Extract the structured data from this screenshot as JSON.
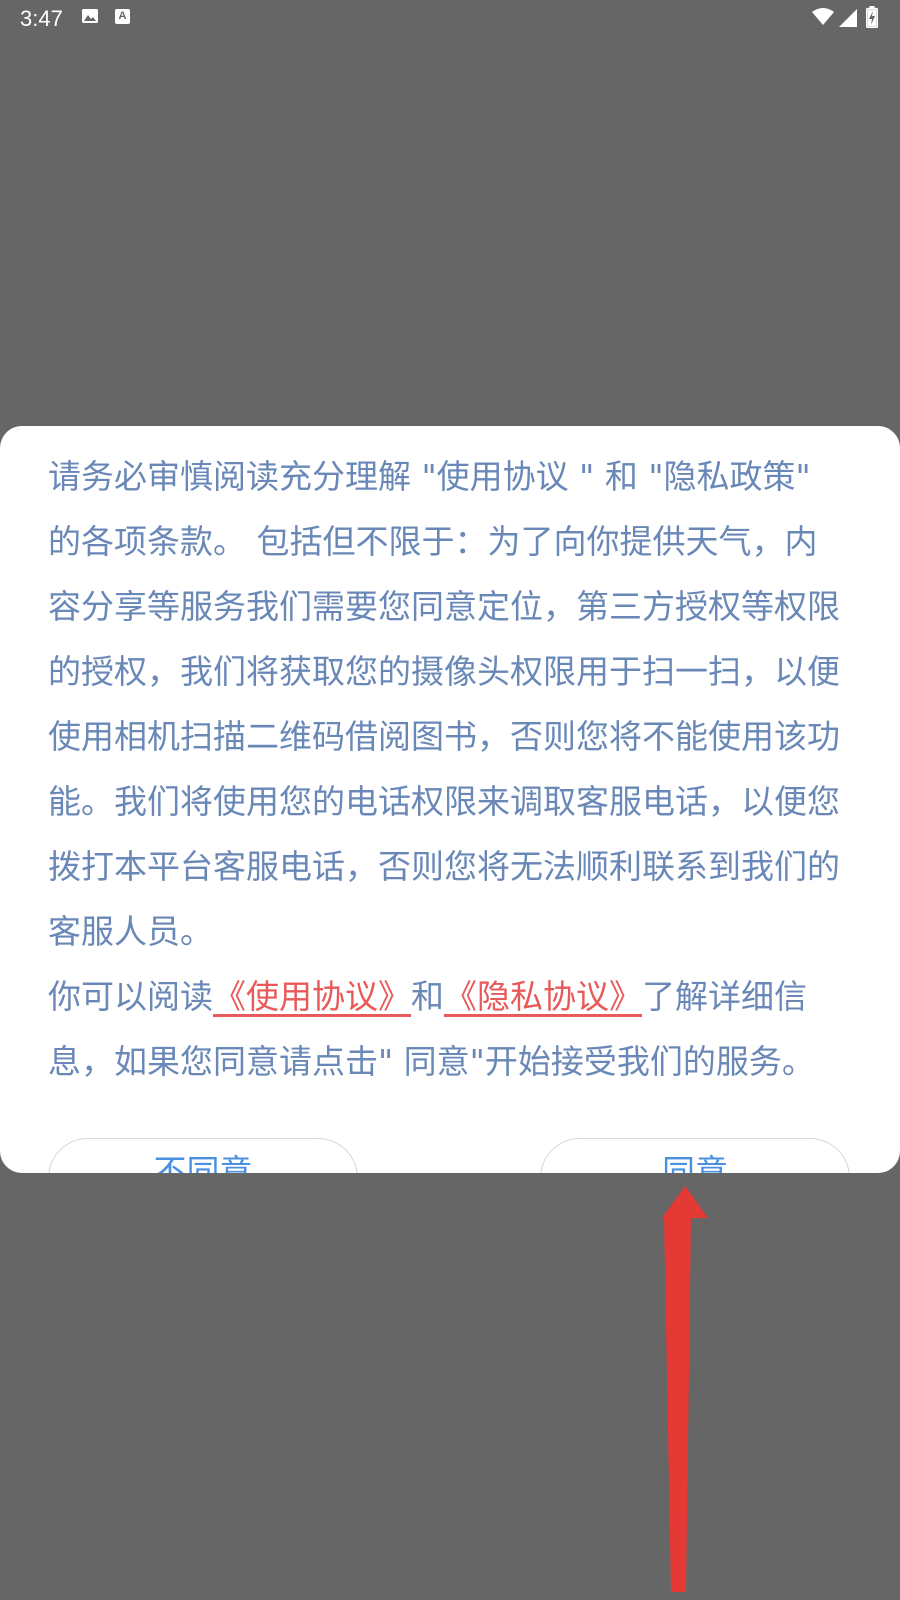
{
  "status_bar": {
    "time": "3:47",
    "notification_icons": [
      "image-icon",
      "text-a-icon"
    ],
    "system_icons": [
      "wifi-icon",
      "signal-icon",
      "battery-charging-icon"
    ]
  },
  "dialog": {
    "paragraph1": "请务必审慎阅读充分理解 \"使用协议 \" 和 \"隐私政策\" 的各项条款。 包括但不限于：为了向你提供天气，内容分享等服务我们需要您同意定位，第三方授权等权限的授权，我们将获取您的摄像头权限用于扫一扫，以便使用相机扫描二维码借阅图书，否则您将不能使用该功能。我们将使用您的电话权限来调取客服电话，以便您拨打本平台客服电话，否则您将无法顺利联系到我们的客服人员。",
    "paragraph2_prefix": "你可以阅读",
    "usage_agreement_link": "《使用协议》",
    "paragraph2_and": "和",
    "privacy_agreement_link": "《隐私协议》",
    "paragraph2_suffix": "了解详细信息，如果您同意请点击\" 同意\"开始接受我们的服务。",
    "disagree_button": "不同意",
    "agree_button": "同意"
  },
  "colors": {
    "overlay": "#666666",
    "body_text": "#6a88b7",
    "link": "#e85a5a",
    "button_text": "#4a90e2",
    "annotation_arrow": "#e53935"
  }
}
